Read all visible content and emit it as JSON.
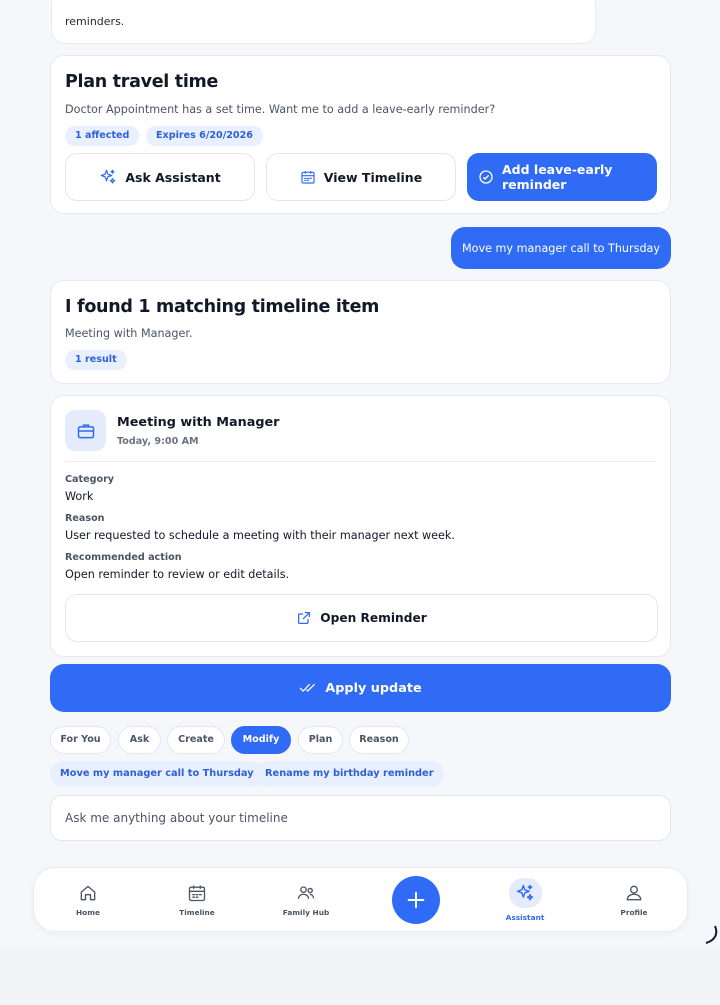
{
  "previous_card": {
    "text": "reminders."
  },
  "plan_card": {
    "title": "Plan travel time",
    "description": "Doctor Appointment has a set time. Want me to add a leave-early reminder?",
    "chips": [
      "1 affected",
      "Expires 6/20/2026"
    ],
    "ask_label": "Ask Assistant",
    "timeline_label": "View Timeline",
    "add_label": "Add leave-early reminder"
  },
  "user_message": "Move my manager call to Thursday",
  "found_card": {
    "title": "I found 1 matching timeline item",
    "description": "Meeting with Manager.",
    "chip": "1 result"
  },
  "meeting_card": {
    "title": "Meeting with Manager",
    "time": "Today, 9:00 AM",
    "category_label": "Category",
    "category_value": "Work",
    "reason_label": "Reason",
    "reason_value": "User requested to schedule a meeting with their manager next week.",
    "action_label": "Recommended action",
    "action_value": "Open reminder to review or edit details.",
    "open_label": "Open Reminder"
  },
  "apply_label": "Apply update",
  "filters": [
    "For You",
    "Ask",
    "Create",
    "Modify",
    "Plan",
    "Reason"
  ],
  "active_filter": "Modify",
  "suggestions": [
    "Move my manager call to Thursday",
    "Rename my birthday reminder"
  ],
  "input": {
    "placeholder": "Ask me anything about your timeline"
  },
  "tabbar": {
    "home": "Home",
    "timeline": "Timeline",
    "family": "Family Hub",
    "assistant": "Assistant",
    "profile": "Profile"
  },
  "colors": {
    "accent": "#2f6bf5",
    "chip_bg": "#e8efff",
    "chip_text": "#2f5fd6"
  }
}
